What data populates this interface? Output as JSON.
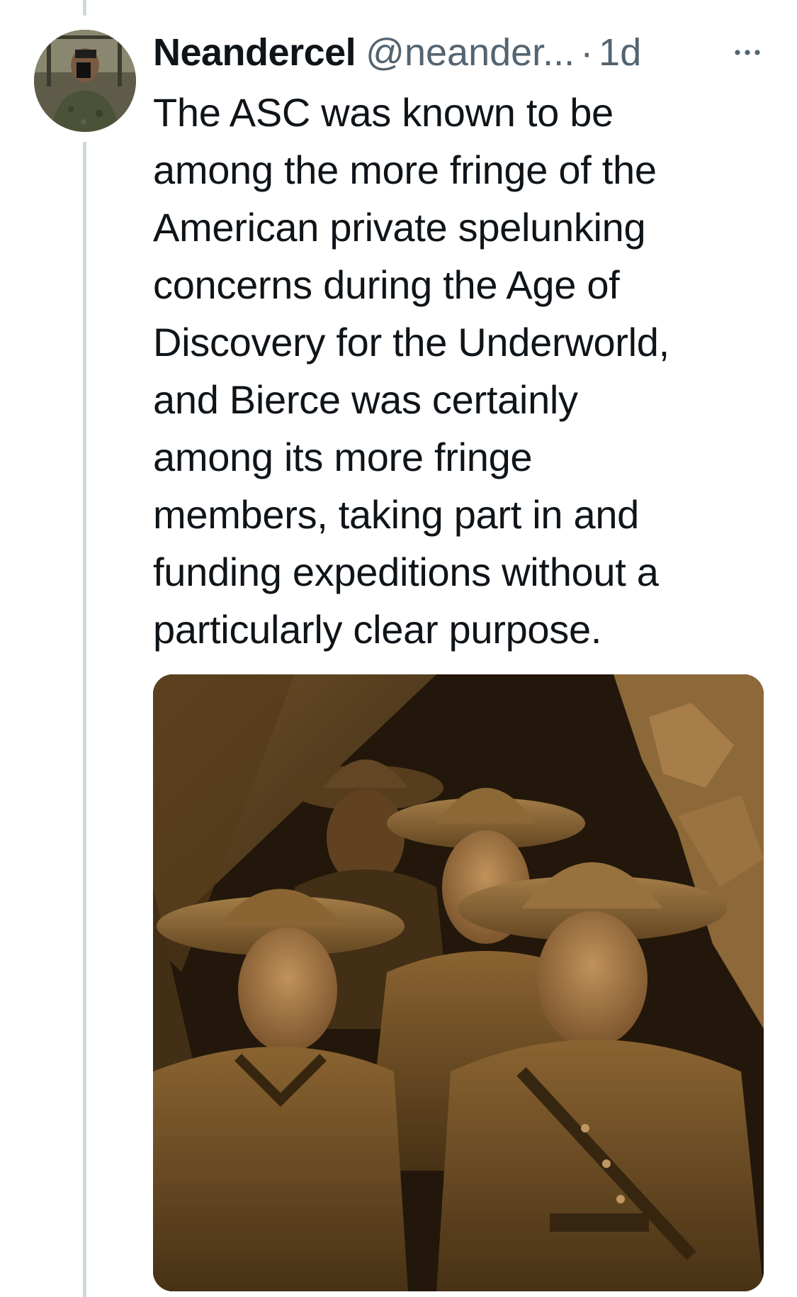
{
  "tweet": {
    "display_name": "Neandercel",
    "handle": "@neander...",
    "separator": "·",
    "time": "1d",
    "text": "The ASC was known to be\namong the more fringe of the\nAmerican private spelunking\nconcerns during the Age of\nDiscovery for the Underworld,\nand Bierce was certainly\namong its more fringe\nmembers, taking part in and\nfunding expeditions without a\nparticularly clear purpose.",
    "avatar_icon": "profile-photo",
    "more_icon": "more-options-icon"
  },
  "colors": {
    "text_primary": "#0f1419",
    "text_secondary": "#536471",
    "thread_line": "#cfd9de",
    "image_sepia_dark": "#2a1e10",
    "image_sepia_light": "#b98f56"
  }
}
